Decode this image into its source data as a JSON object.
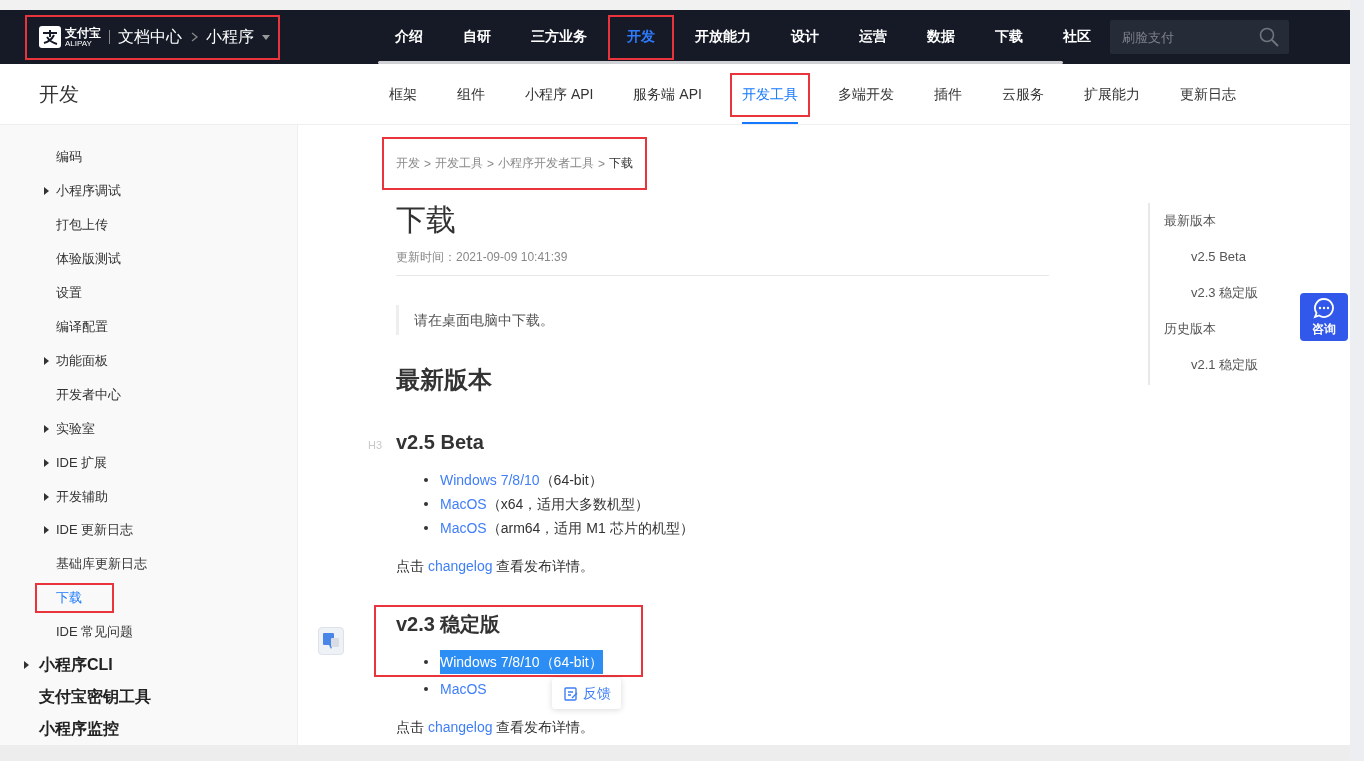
{
  "header": {
    "logo": {
      "name": "支付宝",
      "sub": "ALIPAY"
    },
    "site": "文档中心",
    "product": "小程序",
    "highlighted": true
  },
  "nav": [
    {
      "label": "介绍",
      "selected": false,
      "highlighted": false
    },
    {
      "label": "自研",
      "selected": false,
      "highlighted": false
    },
    {
      "label": "三方业务",
      "selected": false,
      "highlighted": false
    },
    {
      "label": "开发",
      "selected": true,
      "highlighted": true
    },
    {
      "label": "开放能力",
      "selected": false,
      "highlighted": false
    },
    {
      "label": "设计",
      "selected": false,
      "highlighted": false
    },
    {
      "label": "运营",
      "selected": false,
      "highlighted": false
    },
    {
      "label": "数据",
      "selected": false,
      "highlighted": false
    },
    {
      "label": "下载",
      "selected": false,
      "highlighted": false
    },
    {
      "label": "社区",
      "selected": false,
      "highlighted": false
    }
  ],
  "search": {
    "placeholder": "刷脸支付"
  },
  "section_title": "开发",
  "subnav": [
    {
      "label": "框架",
      "selected": false,
      "highlighted": false
    },
    {
      "label": "组件",
      "selected": false,
      "highlighted": false
    },
    {
      "label": "小程序 API",
      "selected": false,
      "highlighted": false
    },
    {
      "label": "服务端 API",
      "selected": false,
      "highlighted": false
    },
    {
      "label": "开发工具",
      "selected": true,
      "highlighted": true
    },
    {
      "label": "多端开发",
      "selected": false,
      "highlighted": false
    },
    {
      "label": "插件",
      "selected": false,
      "highlighted": false
    },
    {
      "label": "云服务",
      "selected": false,
      "highlighted": false
    },
    {
      "label": "扩展能力",
      "selected": false,
      "highlighted": false
    },
    {
      "label": "更新日志",
      "selected": false,
      "highlighted": false
    }
  ],
  "sidebar": {
    "items": [
      {
        "label": "编码",
        "expandable": false,
        "selected": false,
        "highlighted": false
      },
      {
        "label": "小程序调试",
        "expandable": true,
        "selected": false,
        "highlighted": false
      },
      {
        "label": "打包上传",
        "expandable": false,
        "selected": false,
        "highlighted": false
      },
      {
        "label": "体验版测试",
        "expandable": false,
        "selected": false,
        "highlighted": false
      },
      {
        "label": "设置",
        "expandable": false,
        "selected": false,
        "highlighted": false
      },
      {
        "label": "编译配置",
        "expandable": false,
        "selected": false,
        "highlighted": false
      },
      {
        "label": "功能面板",
        "expandable": true,
        "selected": false,
        "highlighted": false
      },
      {
        "label": "开发者中心",
        "expandable": false,
        "selected": false,
        "highlighted": false
      },
      {
        "label": "实验室",
        "expandable": true,
        "selected": false,
        "highlighted": false
      },
      {
        "label": "IDE 扩展",
        "expandable": true,
        "selected": false,
        "highlighted": false
      },
      {
        "label": "开发辅助",
        "expandable": true,
        "selected": false,
        "highlighted": false
      },
      {
        "label": "IDE 更新日志",
        "expandable": true,
        "selected": false,
        "highlighted": false
      },
      {
        "label": "基础库更新日志",
        "expandable": false,
        "selected": false,
        "highlighted": false
      },
      {
        "label": "下载",
        "expandable": false,
        "selected": true,
        "highlighted": true
      },
      {
        "label": "IDE 常见问题",
        "expandable": false,
        "selected": false,
        "highlighted": false
      }
    ],
    "sections": [
      {
        "label": "小程序CLI",
        "expandable": true
      },
      {
        "label": "支付宝密钥工具",
        "expandable": false
      },
      {
        "label": "小程序监控",
        "expandable": false
      }
    ]
  },
  "breadcrumb": {
    "highlighted": true,
    "items": [
      {
        "label": "开发",
        "current": false
      },
      {
        "label": "开发工具",
        "current": false
      },
      {
        "label": "小程序开发者工具",
        "current": false
      },
      {
        "label": "下载",
        "current": true
      }
    ],
    "separators": [
      ">",
      ">",
      ">"
    ]
  },
  "article": {
    "title": "下载",
    "updated": "更新时间：2021-09-09 10:41:39",
    "note": "请在桌面电脑中下载。",
    "heading": "最新版本",
    "versions": [
      {
        "title": "v2.5 Beta",
        "anchor": "H3",
        "highlighted": false,
        "links": [
          {
            "link": "Windows 7/8/10",
            "detail": "（64-bit）",
            "selected": false,
            "highlighted": false
          },
          {
            "link": "MacOS",
            "detail": "（x64，适用大多数机型）",
            "selected": false,
            "highlighted": false
          },
          {
            "link": "MacOS",
            "detail": "（arm64，适用 M1 芯片的机型）",
            "selected": false,
            "highlighted": false
          }
        ],
        "footer": {
          "before": "点击 ",
          "link": "changelog",
          "after": " 查看发布详情。"
        }
      },
      {
        "title": "v2.3 稳定版",
        "highlighted": true,
        "links": [
          {
            "link": "Windows 7/8/10",
            "detail": "（64-bit）",
            "selected": true,
            "highlighted": true
          },
          {
            "link": "MacOS",
            "selected": false,
            "highlighted": false
          }
        ],
        "footer": {
          "before": "点击 ",
          "link": "changelog",
          "after": " 查看发布详情。"
        }
      }
    ]
  },
  "toc": {
    "items": [
      {
        "label": "最新版本",
        "children": [
          {
            "label": "v2.5 Beta"
          },
          {
            "label": "v2.3 稳定版"
          }
        ]
      },
      {
        "label": "历史版本",
        "children": [
          {
            "label": "v2.1 稳定版"
          }
        ]
      }
    ]
  },
  "consult": {
    "label": "咨询"
  },
  "feedback": {
    "label": "反馈"
  }
}
